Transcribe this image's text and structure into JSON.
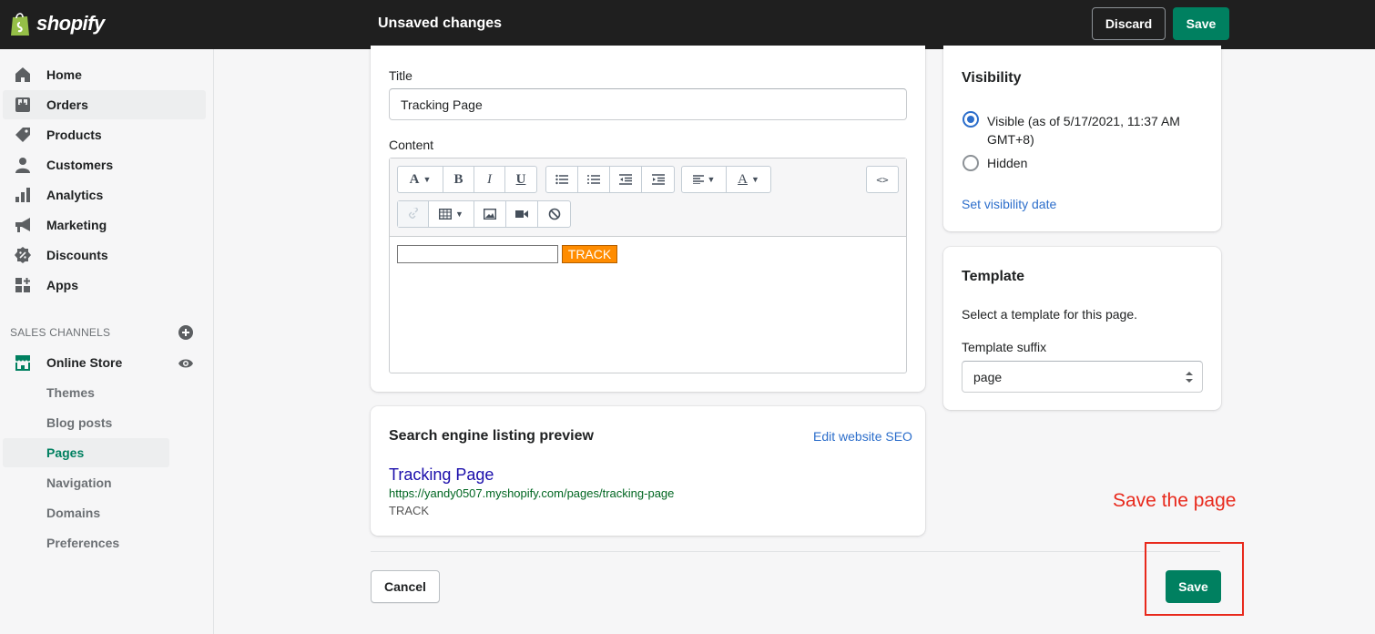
{
  "topbar": {
    "brand": "shopify",
    "title": "Unsaved changes",
    "discard_label": "Discard",
    "save_label": "Save"
  },
  "sidebar": {
    "items": [
      {
        "label": "Home",
        "icon": "home-icon"
      },
      {
        "label": "Orders",
        "icon": "orders-icon"
      },
      {
        "label": "Products",
        "icon": "tag-icon"
      },
      {
        "label": "Customers",
        "icon": "person-icon"
      },
      {
        "label": "Analytics",
        "icon": "bar-chart-icon"
      },
      {
        "label": "Marketing",
        "icon": "megaphone-icon"
      },
      {
        "label": "Discounts",
        "icon": "discount-icon"
      },
      {
        "label": "Apps",
        "icon": "apps-icon"
      }
    ],
    "sales_channels_heading": "SALES CHANNELS",
    "online_store": "Online Store",
    "sub_items": [
      "Themes",
      "Blog posts",
      "Pages",
      "Navigation",
      "Domains",
      "Preferences"
    ],
    "active_sub_item": "Pages"
  },
  "page_form": {
    "title_label": "Title",
    "title_value": "Tracking Page",
    "content_label": "Content",
    "track_button_label": "TRACK"
  },
  "seo": {
    "heading": "Search engine listing preview",
    "edit_link": "Edit website SEO",
    "preview_title": "Tracking Page",
    "preview_url": "https://yandy0507.myshopify.com/pages/tracking-page",
    "preview_description": "TRACK"
  },
  "visibility": {
    "heading": "Visibility",
    "visible_label": "Visible (as of 5/17/2021, 11:37 AM GMT+8)",
    "hidden_label": "Hidden",
    "set_date_link": "Set visibility date",
    "selected": "Visible"
  },
  "template": {
    "heading": "Template",
    "description": "Select a template for this page.",
    "suffix_label": "Template suffix",
    "suffix_value": "page"
  },
  "footer": {
    "cancel_label": "Cancel",
    "save_label": "Save"
  },
  "annotation": {
    "text": "Save the page",
    "color": "#e8291c"
  },
  "colors": {
    "primary": "#008060",
    "link": "#2c6ecb",
    "topbar": "#1f1f1f",
    "track_button": "#ff8c00"
  }
}
